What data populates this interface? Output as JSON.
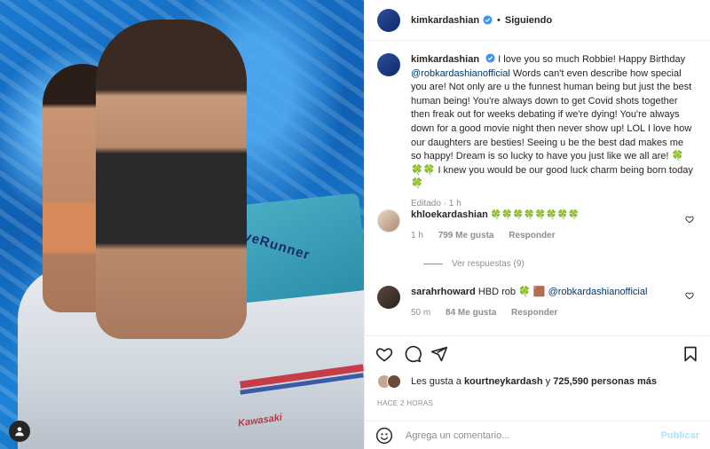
{
  "post": {
    "author": "kimkardashian",
    "follow_status": "Siguiendo",
    "photo_brand_text": "WaveRunner",
    "photo_stern_text": "Kawasaki"
  },
  "caption": {
    "author": "kimkardashian",
    "text_1": "I love you so much Robbie! Happy Birthday",
    "mention": "@robkardashianofficial",
    "text_2": "Words can't even describe how special you are! Not only are u the funnest human being but just the best human being! You're always down to get Covid shots together then freak out for weeks debating if we're dying! You're always down for a good movie night then never show up! LOL I love how our daughters are besties! Seeing u be the best dad makes me so happy! Dream is so lucky to have you just like we all are! 🍀🍀🍀 I knew you would be our good luck charm being born today 🍀",
    "meta": "Editado · 1 h"
  },
  "comments": [
    {
      "user": "khloekardashian",
      "text": "🍀🍀🍀🍀🍀🍀🍀🍀",
      "time": "1 h",
      "likes": "799 Me gusta",
      "reply": "Responder"
    },
    {
      "user": "sarahrhoward",
      "text": "HBD rob 🍀 🟫",
      "mention": "@robkardashianofficial",
      "time": "50 m",
      "likes": "84 Me gusta",
      "reply": "Responder"
    }
  ],
  "replies_label": "Ver respuestas (9)",
  "likes": {
    "prefix": "Les gusta a",
    "user": "kourtneykardash",
    "suffix": "y",
    "count": "725,590 personas más"
  },
  "timestamp": "HACE 2 HORAS",
  "add_comment": {
    "placeholder": "Agrega un comentario...",
    "publish": "Publicar"
  },
  "icons": [
    "heart-icon",
    "comment-icon",
    "share-icon",
    "bookmark-icon",
    "emoji-icon",
    "verified-icon",
    "tagged-user-icon"
  ],
  "colors": {
    "verified": "#3897f0",
    "mention": "#00376b",
    "publish_disabled": "#b2dffc"
  }
}
